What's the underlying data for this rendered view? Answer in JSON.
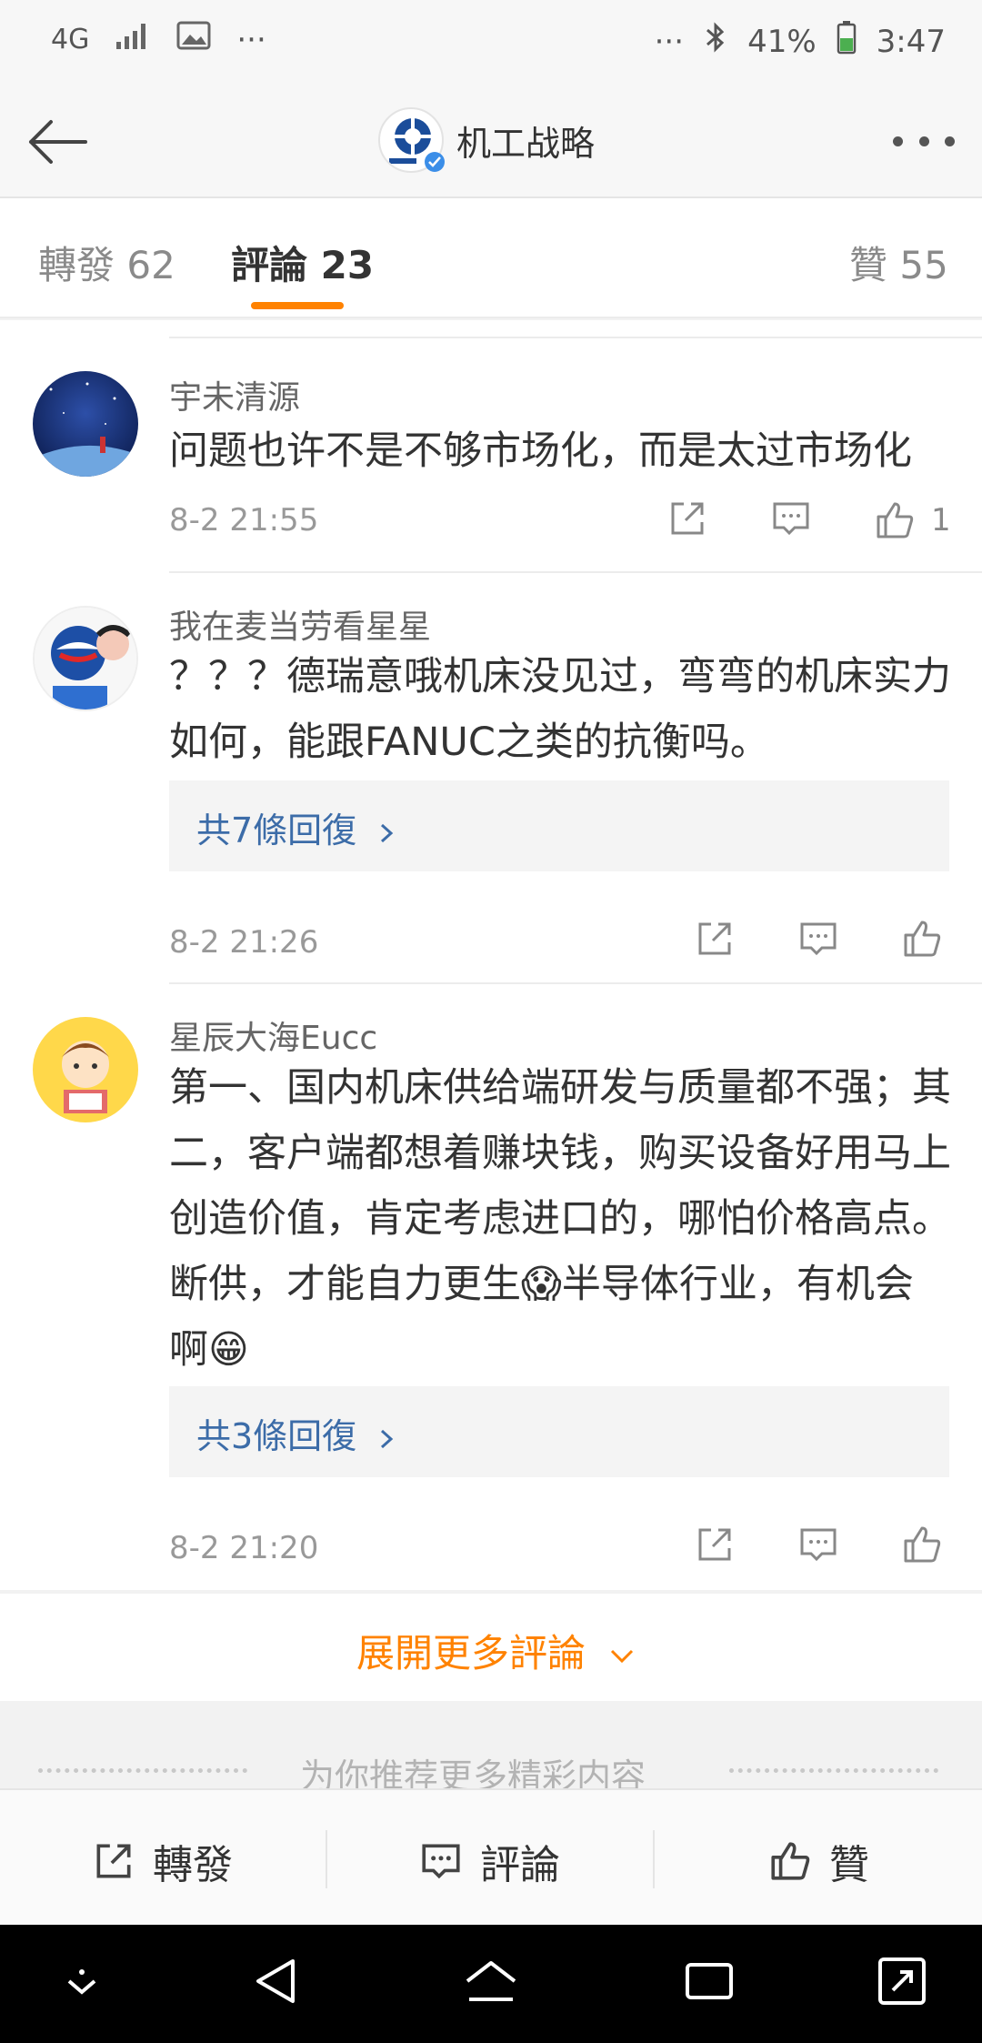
{
  "status_bar": {
    "network": "4G",
    "dots": "···",
    "battery": "41%",
    "time": "3:47"
  },
  "nav": {
    "title": "机工战略"
  },
  "tabs": [
    {
      "label": "轉發",
      "count": "62",
      "active": false
    },
    {
      "label": "評論",
      "count": "23",
      "active": true
    },
    {
      "label": "贊",
      "count": "55",
      "active": false
    }
  ],
  "comments": [
    {
      "user": "宇未清源",
      "text": "问题也许不是不够市场化，而是太过市场化",
      "time": "8-2 21:55",
      "likes": "1",
      "replies": ""
    },
    {
      "user": "我在麦当劳看星星",
      "text": "？？？德瑞意哦机床没见过，弯弯的机床实力如何，能跟FANUC之类的抗衡吗。",
      "time": "8-2 21:26",
      "likes": "",
      "replies": "共7條回復"
    },
    {
      "user": "星辰大海Eucc",
      "text": "第一、国内机床供给端研发与质量都不强；其二，客户端都想着赚块钱，购买设备好用马上创造价值，肯定考虑进口的，哪怕价格高点。断供，才能自力更生😱半导体行业，有机会啊😁",
      "time": "8-2 21:20",
      "likes": "",
      "replies": "共3條回復"
    }
  ],
  "expand_more": "展開更多評論",
  "recommend": "为你推荐更多精彩内容",
  "bottom_bar": {
    "repost": "轉發",
    "comment": "評論",
    "like": "贊"
  },
  "colors": {
    "accent": "#ff8200",
    "link": "#3c6ca8"
  }
}
